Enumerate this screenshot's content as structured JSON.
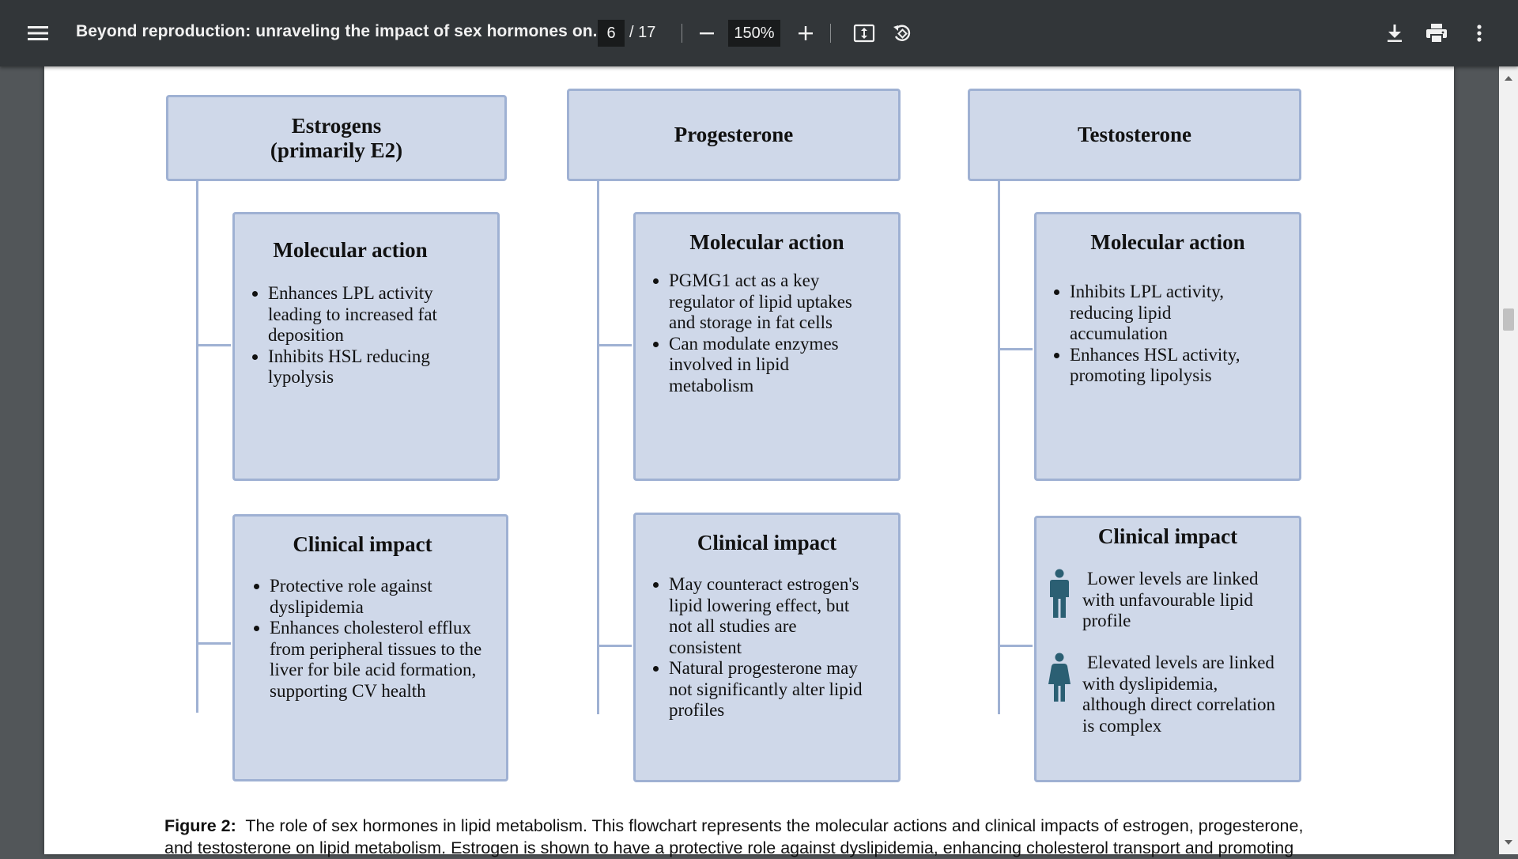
{
  "toolbar": {
    "title": "Beyond reproduction: unraveling the impact of sex hormones on...",
    "page_current": "6",
    "page_total": "/ 17",
    "zoom": "150%"
  },
  "icons": {
    "menu": "menu-icon",
    "zoom_out": "minus-icon",
    "zoom_in": "plus-icon",
    "fit": "fit-page-icon",
    "rotate": "rotate-icon",
    "download": "download-icon",
    "print": "print-icon",
    "more": "more-vert-icon"
  },
  "figure": {
    "estrogens": {
      "title_line1": "Estrogens",
      "title_line2": "(primarily E2)",
      "molecular_title": "Molecular action",
      "molecular_items": [
        "Enhances LPL activity leading to increased fat deposition",
        "Inhibits HSL reducing lypolysis"
      ],
      "clinical_title": "Clinical impact",
      "clinical_items": [
        "Protective role against dyslipidemia",
        "Enhances cholesterol efflux from peripheral tissues to the liver for bile acid formation, supporting CV health"
      ]
    },
    "progesterone": {
      "title": "Progesterone",
      "molecular_title": "Molecular action",
      "molecular_items": [
        "PGMG1 act as a key regulator of lipid uptakes and storage in fat cells",
        "Can modulate enzymes involved in lipid metabolism"
      ],
      "clinical_title": "Clinical impact",
      "clinical_items": [
        "May counteract estrogen's lipid lowering effect, but not all studies are consistent",
        "Natural progesterone may not significantly alter lipid profiles"
      ]
    },
    "testosterone": {
      "title": "Testosterone",
      "molecular_title": "Molecular action",
      "molecular_items": [
        "Inhibits LPL activity, reducing lipid accumulation",
        "Enhances HSL activity, promoting lipolysis"
      ],
      "clinical_title": "Clinical impact",
      "clinical_male_text": "Lower levels are linked with unfavourable lipid profile",
      "clinical_female_text": "Elevated levels are linked with dyslipidemia, although direct correlation is complex"
    }
  },
  "caption": {
    "label": "Figure 2:",
    "text_line1": "The role of sex hormones in lipid metabolism. This flowchart represents the molecular actions and clinical impacts of estrogen, progesterone,",
    "text_line2": "and testosterone on lipid metabolism. Estrogen is shown to have a protective role against dyslipidemia, enhancing cholesterol transport and promoting"
  },
  "colors": {
    "toolbar_bg": "#323639",
    "viewer_bg": "#525659",
    "box_fill": "#cfd8e9",
    "box_border": "#9fb1d3",
    "person_icon": "#2b5f73"
  }
}
